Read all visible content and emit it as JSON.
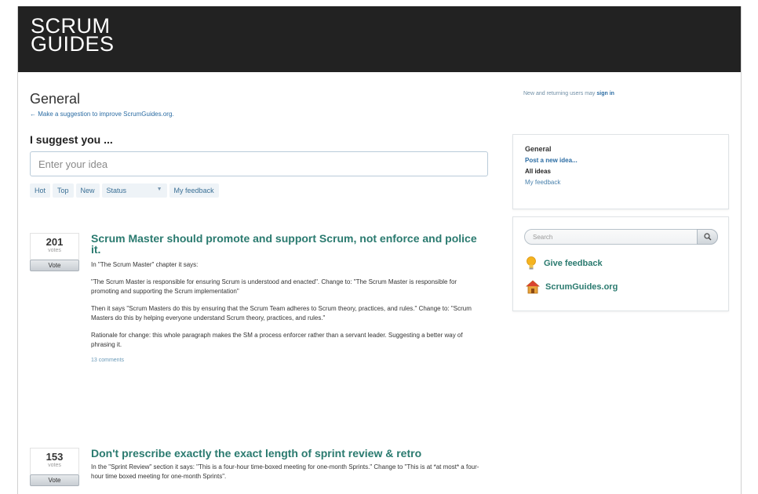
{
  "header": {
    "logo_line1": "SCRUM",
    "logo_line2": "GUIDES"
  },
  "forum": {
    "title": "General",
    "suggestion_link": "← Make a suggestion to improve ScrumGuides.org.",
    "suggest_heading": "I suggest you ...",
    "input_placeholder": "Enter your idea"
  },
  "filters": {
    "hot": "Hot",
    "top": "Top",
    "new": "New",
    "status": "Status",
    "feedback": "My feedback"
  },
  "ideas": [
    {
      "votes": "201",
      "votes_label": "votes",
      "vote_button": "Vote",
      "title": "Scrum Master should promote and support Scrum, not enforce and police it.",
      "paragraphs": [
        "In \"The Scrum Master\" chapter it says:",
        "\"The Scrum Master is responsible for ensuring Scrum is understood and enacted\". Change to: \"The Scrum Master is responsible for promoting and supporting the Scrum implementation\"",
        "Then it says \"Scrum Masters do this by ensuring that the Scrum Team adheres to Scrum theory, practices, and rules.\" Change to: \"Scrum Masters do this by helping everyone understand Scrum theory, practices, and rules.\"",
        "Rationale for change: this whole paragraph makes the SM a process enforcer rather than a servant leader. Suggesting a better way of phrasing it."
      ],
      "comments": "13 comments"
    },
    {
      "votes": "153",
      "votes_label": "votes",
      "vote_button": "Vote",
      "title": "Don't prescribe exactly the exact length of sprint review & retro",
      "paragraphs": [
        "In the \"Sprint Review\" section it says: \"This is a four-hour time-boxed meeting for one-month Sprints.\" Change to \"This is at *at most* a four-hour time boxed meeting for one-month Sprints\"."
      ]
    }
  ],
  "sidebar": {
    "signin_text": "New and returning users may",
    "signin_link": "sign in",
    "nav_heading": "General",
    "post_idea": "Post a new idea...",
    "all_ideas": "All ideas",
    "my_feedback": "My feedback",
    "search_placeholder": "Search",
    "give_feedback": "Give feedback",
    "site_link": "ScrumGuides.org"
  },
  "colors": {
    "topbar": "#222222",
    "title_teal": "#2a7a6f",
    "link_blue": "#2b6ca3"
  }
}
